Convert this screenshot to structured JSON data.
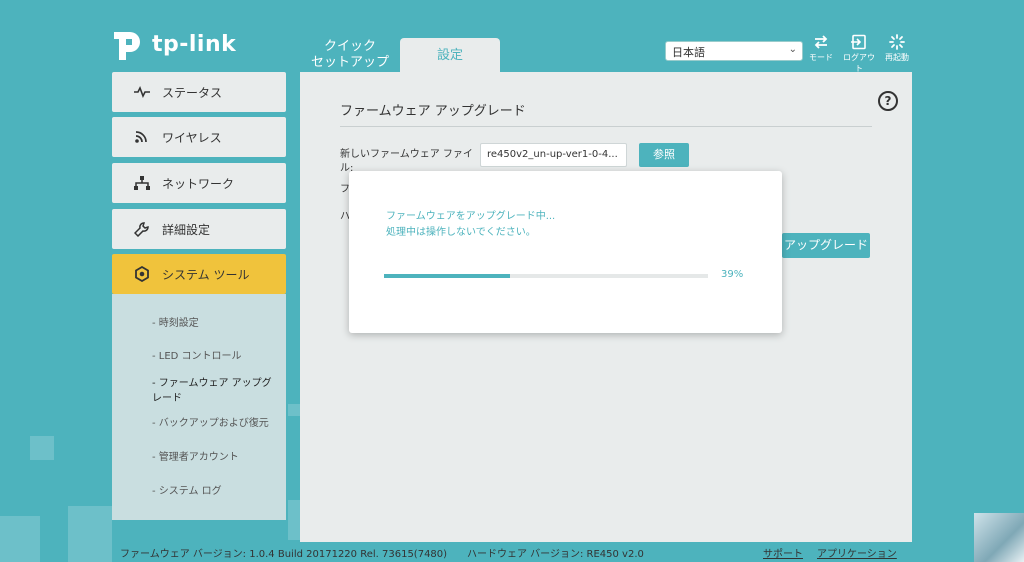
{
  "header": {
    "logo_text": "tp-link",
    "tabs": [
      {
        "label": "クイック\nセットアップ"
      },
      {
        "label": "設定"
      }
    ],
    "language": "日本語",
    "icons": [
      {
        "name": "mode-icon",
        "label": "モード"
      },
      {
        "name": "logout-icon",
        "label": "ログアウト"
      },
      {
        "name": "reboot-icon",
        "label": "再起動"
      }
    ]
  },
  "sidebar": {
    "items": [
      {
        "label": "ステータス",
        "icon": "status-icon"
      },
      {
        "label": "ワイヤレス",
        "icon": "wireless-icon"
      },
      {
        "label": "ネットワーク",
        "icon": "network-icon"
      },
      {
        "label": "詳細設定",
        "icon": "advanced-icon"
      },
      {
        "label": "システム ツール",
        "icon": "system-tools-icon"
      }
    ],
    "subitems": [
      {
        "label": "-  時刻設定"
      },
      {
        "label": "-  LED コントロール"
      },
      {
        "label": "-  ファームウェア アップグ\n    レード"
      },
      {
        "label": "-  バックアップおよび復元"
      },
      {
        "label": "-  管理者アカウント"
      },
      {
        "label": "-  システム ログ"
      }
    ]
  },
  "main": {
    "title": "ファームウェア アップグレード",
    "help": "?",
    "new_file_label": "新しいファームウェア ファイル:",
    "file_value": "re450v2_un-up-ver1-0-4...",
    "browse_button": "参照",
    "label_f": "フ",
    "label_h": "ハ",
    "upgrade_button": "アップグレード"
  },
  "dialog": {
    "line1": "ファームウェアをアップグレード中...",
    "line2": "処理中は操作しないでください。",
    "progress": 0.39,
    "progress_label": "39%"
  },
  "footer": {
    "firmware": "ファームウェア バージョン: 1.0.4 Build 20171220 Rel. 73615(7480)",
    "hardware": "ハードウェア バージョン: RE450 v2.0",
    "support": "サポート",
    "app": "アプリケーション"
  },
  "colors": {
    "background": "#4db3bd",
    "accent": "#4db3bd",
    "active_menu": "#f0c33c",
    "panel": "#e9ecec"
  }
}
